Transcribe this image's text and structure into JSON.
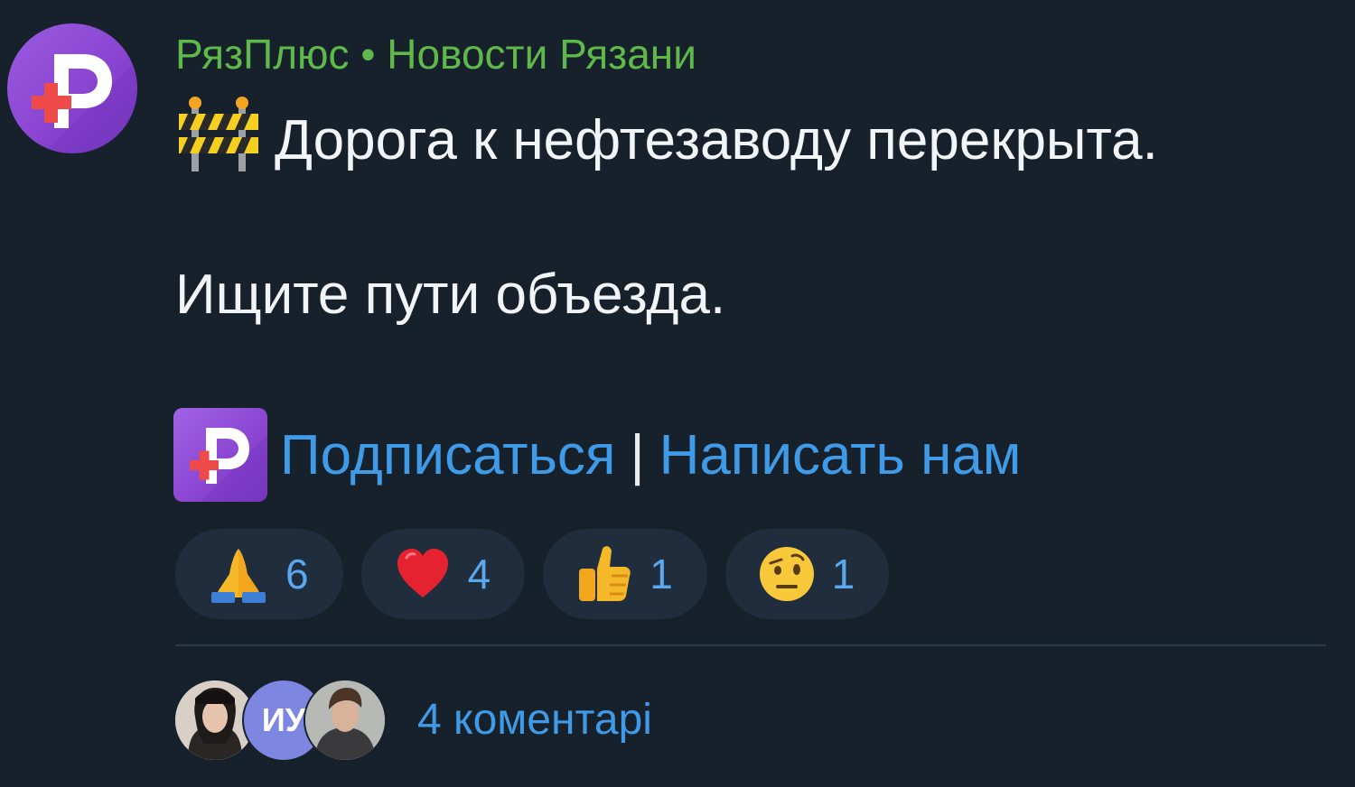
{
  "post": {
    "channel_name": "РязПлюс • Новости Рязани",
    "message_line1": "Дорога к нефтезаводу перекрыта.",
    "message_line2": "Ищите пути объезда.",
    "links": {
      "subscribe": "Подписаться",
      "separator": "|",
      "write_us": "Написать нам"
    },
    "reactions": [
      {
        "emoji": "folded-hands",
        "count": "6"
      },
      {
        "emoji": "red-heart",
        "count": "4"
      },
      {
        "emoji": "thumbs-up",
        "count": "1"
      },
      {
        "emoji": "face-with-raised-eyebrow",
        "count": "1"
      }
    ],
    "comments": {
      "avatar_initials": "ИУ",
      "label": "4 коментарі"
    }
  },
  "colors": {
    "background": "#17212b",
    "channel_name": "#5fb84a",
    "link": "#3f9ae8",
    "reaction_bg": "#1f2d3c",
    "brand_purple": "#8a45d1"
  }
}
